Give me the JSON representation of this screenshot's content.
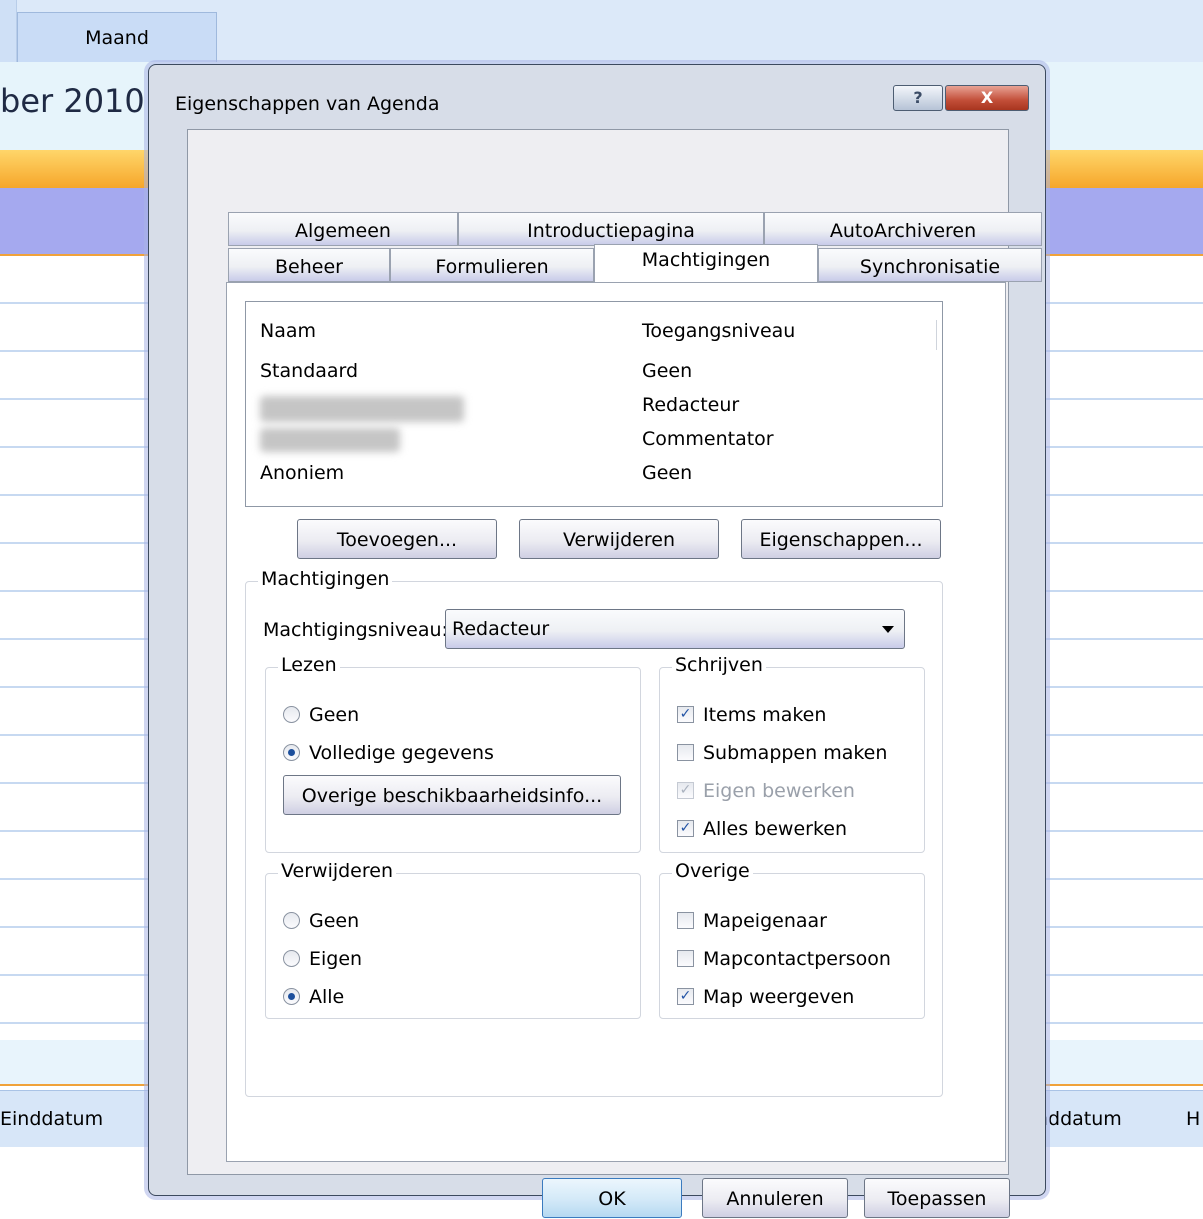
{
  "background": {
    "view_tab": "Maand",
    "date_fragment": "ber 2010",
    "footer_left": "Einddatum",
    "footer_right": "nddatum",
    "footer_far_right": "H"
  },
  "dialog": {
    "title": "Eigenschappen van Agenda",
    "help_icon": "?",
    "close_icon": "X",
    "tabs_row1": [
      "Algemeen",
      "Introductiepagina",
      "AutoArchiveren"
    ],
    "tabs_row2": [
      "Beheer",
      "Formulieren",
      "Machtigingen",
      "Synchronisatie"
    ],
    "active_tab": "Machtigingen",
    "list": {
      "columns": [
        "Naam",
        "Toegangsniveau"
      ],
      "rows": [
        {
          "name": "Standaard",
          "level": "Geen"
        },
        {
          "name": "",
          "level": "Redacteur"
        },
        {
          "name": "",
          "level": "Commentator"
        },
        {
          "name": "Anoniem",
          "level": "Geen"
        }
      ]
    },
    "buttons": {
      "add": "Toevoegen...",
      "remove": "Verwijderen",
      "properties": "Eigenschappen..."
    },
    "permissions": {
      "group_label": "Machtigingen",
      "level_label": "Machtigingsniveau:",
      "level_value": "Redacteur",
      "read": {
        "label": "Lezen",
        "options": [
          "Geen",
          "Volledige gegevens"
        ],
        "selected": "Volledige gegevens",
        "button": "Overige beschikbaarheidsinfo..."
      },
      "write": {
        "label": "Schrijven",
        "items": [
          {
            "label": "Items maken",
            "checked": true,
            "enabled": true
          },
          {
            "label": "Submappen maken",
            "checked": false,
            "enabled": true
          },
          {
            "label": "Eigen bewerken",
            "checked": true,
            "enabled": false
          },
          {
            "label": "Alles bewerken",
            "checked": true,
            "enabled": true
          }
        ]
      },
      "delete": {
        "label": "Verwijderen",
        "options": [
          "Geen",
          "Eigen",
          "Alle"
        ],
        "selected": "Alle"
      },
      "other": {
        "label": "Overige",
        "items": [
          {
            "label": "Mapeigenaar",
            "checked": false
          },
          {
            "label": "Mapcontactpersoon",
            "checked": false
          },
          {
            "label": "Map weergeven",
            "checked": true
          }
        ]
      }
    },
    "footer": {
      "ok": "OK",
      "cancel": "Annuleren",
      "apply": "Toepassen"
    }
  }
}
